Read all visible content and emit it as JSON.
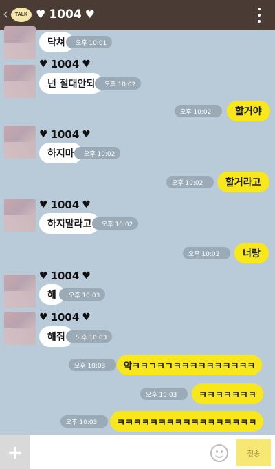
{
  "header": {
    "back_glyph": "‹",
    "badge": "TALK",
    "title": "1004",
    "heart": "♥"
  },
  "sender_name": "1004",
  "messages": [
    {
      "dir": "in",
      "text": "닥쳐",
      "time": "오후 10:01"
    },
    {
      "dir": "in",
      "text": "넌 절대안되",
      "time": "오후 10:02"
    },
    {
      "dir": "out",
      "text": "할거야",
      "time": "오후 10:02"
    },
    {
      "dir": "in",
      "text": "하지마",
      "time": "오후 10:02"
    },
    {
      "dir": "out",
      "text": "할거라고",
      "time": "오후 10:02"
    },
    {
      "dir": "in",
      "text": "하지말라고",
      "time": "오후 10:02"
    },
    {
      "dir": "out",
      "text": "너랑",
      "time": "오후 10:02"
    },
    {
      "dir": "in",
      "text": "해",
      "time": "오후 10:03"
    },
    {
      "dir": "in",
      "text": "해줘",
      "time": "오후 10:03"
    },
    {
      "dir": "out",
      "text": "악ㅋㅋㄱㅋㄱㅋㅋㅋㅋㅋㅋㅋㅋㅋㅋ",
      "time": "오후 10:03"
    },
    {
      "dir": "out",
      "text": "ㅋㅋㅋㅋㅋㅋㅋ",
      "time": "오후 10:03"
    },
    {
      "dir": "out",
      "text": "ㅋㅋㅋㅋㅋㅋㅋㅋㅋㅋㅋㅋㅋㅋㅋㅋㅋ",
      "time": "오후 10:03"
    }
  ],
  "input": {
    "value": "",
    "placeholder": ""
  },
  "buttons": {
    "plus": "+",
    "send": "전송"
  },
  "icons": {
    "back": "chevron-left-icon",
    "menu": "kebab-menu-icon",
    "emoji": "smiley-icon",
    "plus": "plus-icon"
  },
  "colors": {
    "header": "#4a3c34",
    "background": "#b9cbd9",
    "outgoing": "#f8e71c",
    "incoming": "#ffffff",
    "timestamp": "#9aaab6"
  }
}
